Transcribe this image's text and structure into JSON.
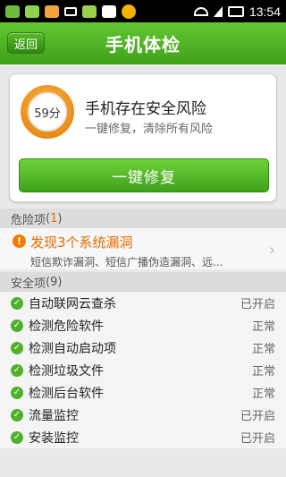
{
  "status_bar": {
    "time": "13:54",
    "icons": [
      "app-icon-1",
      "app-icon-2",
      "app-icon-3",
      "usb-icon",
      "android-icon",
      "sim-icon",
      "plus-badge-icon",
      "wifi-icon",
      "signal-icon",
      "battery-icon"
    ],
    "colors": {
      "background": "#000000"
    }
  },
  "header": {
    "back_label": "返回",
    "title": "手机体检"
  },
  "risk_card": {
    "score": "59分",
    "title": "手机存在安全风险",
    "subtitle": "一键修复，清除所有风险",
    "button_label": "一键修复"
  },
  "danger_section": {
    "label": "危险项",
    "count": "1",
    "items": [
      {
        "title": "发现3个系统漏洞",
        "desc": "短信欺诈漏洞、短信广播伪造漏洞、远..."
      }
    ]
  },
  "safe_section": {
    "label": "安全项",
    "count": "9",
    "items": [
      {
        "label": "自动联网云查杀",
        "status": "已开启"
      },
      {
        "label": "检测危险软件",
        "status": "正常"
      },
      {
        "label": "检测自动启动项",
        "status": "正常"
      },
      {
        "label": "检测垃圾文件",
        "status": "正常"
      },
      {
        "label": "检测后台软件",
        "status": "正常"
      },
      {
        "label": "流量监控",
        "status": "已开启"
      },
      {
        "label": "安装监控",
        "status": "已开启"
      }
    ]
  },
  "colors": {
    "accent": "#4fb12a",
    "warning": "#e36d00"
  }
}
